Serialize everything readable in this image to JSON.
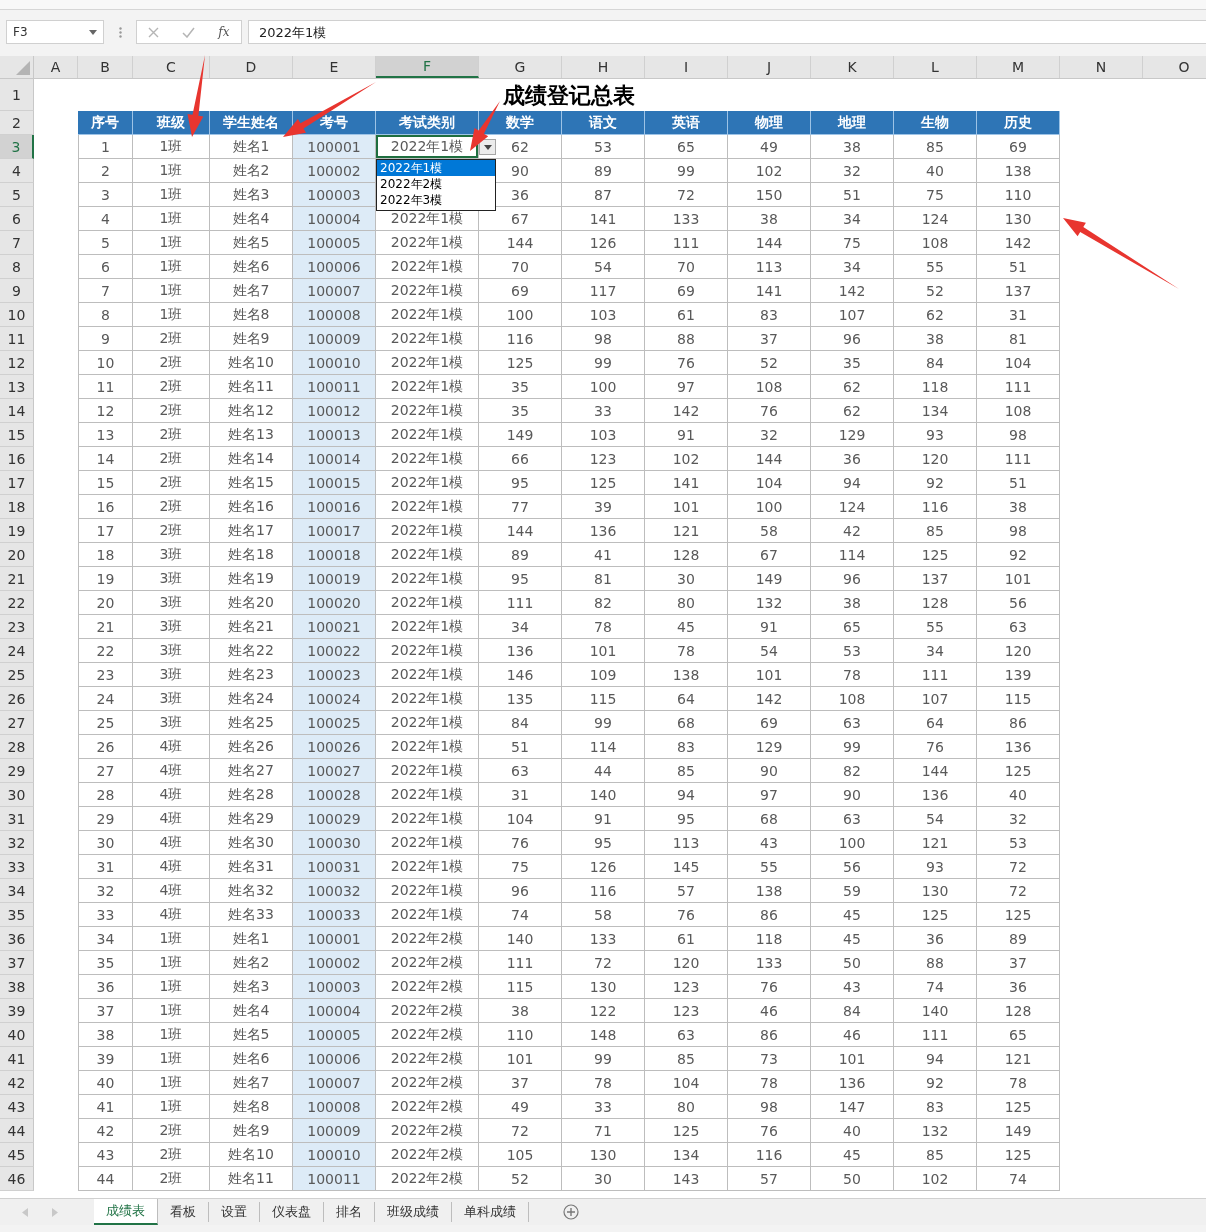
{
  "name_box": "F3",
  "formula_bar": {
    "function_label": "fx",
    "value": "2022年1模"
  },
  "column_headers": [
    {
      "label": "A",
      "selected": false
    },
    {
      "label": "B",
      "selected": false
    },
    {
      "label": "C",
      "selected": false
    },
    {
      "label": "D",
      "selected": false
    },
    {
      "label": "E",
      "selected": false
    },
    {
      "label": "F",
      "selected": true
    },
    {
      "label": "G",
      "selected": false
    },
    {
      "label": "H",
      "selected": false
    },
    {
      "label": "I",
      "selected": false
    },
    {
      "label": "J",
      "selected": false
    },
    {
      "label": "K",
      "selected": false
    },
    {
      "label": "L",
      "selected": false
    },
    {
      "label": "M",
      "selected": false
    },
    {
      "label": "N",
      "selected": false
    },
    {
      "label": "O",
      "selected": false
    }
  ],
  "row_headers": [
    {
      "label": "1"
    },
    {
      "label": "2"
    },
    {
      "label": "3"
    },
    {
      "label": "4"
    },
    {
      "label": "5"
    },
    {
      "label": "6"
    },
    {
      "label": "7"
    },
    {
      "label": "8"
    },
    {
      "label": "9"
    },
    {
      "label": "10"
    },
    {
      "label": "11"
    },
    {
      "label": "12"
    },
    {
      "label": "13"
    },
    {
      "label": "14"
    },
    {
      "label": "15"
    },
    {
      "label": "16"
    },
    {
      "label": "17"
    },
    {
      "label": "18"
    },
    {
      "label": "19"
    },
    {
      "label": "20"
    },
    {
      "label": "21"
    },
    {
      "label": "22"
    },
    {
      "label": "23"
    },
    {
      "label": "24"
    },
    {
      "label": "25"
    },
    {
      "label": "26"
    },
    {
      "label": "27"
    },
    {
      "label": "28"
    },
    {
      "label": "29"
    },
    {
      "label": "30"
    },
    {
      "label": "31"
    },
    {
      "label": "32"
    },
    {
      "label": "33"
    },
    {
      "label": "34"
    },
    {
      "label": "35"
    },
    {
      "label": "36"
    },
    {
      "label": "37"
    },
    {
      "label": "38"
    },
    {
      "label": "39"
    },
    {
      "label": "40"
    },
    {
      "label": "41"
    },
    {
      "label": "42"
    },
    {
      "label": "43"
    },
    {
      "label": "44"
    },
    {
      "label": "45"
    },
    {
      "label": "46"
    }
  ],
  "title": "成绩登记总表",
  "table": {
    "columns": [
      "序号",
      "班级",
      "学生姓名",
      "考号",
      "考试类别",
      "数学",
      "语文",
      "英语",
      "物理",
      "地理",
      "生物",
      "历史"
    ],
    "rows": [
      {
        "selected": true,
        "cells": [
          "1",
          "1班",
          "姓名1",
          "100001",
          "2022年1模",
          "62",
          "53",
          "65",
          "49",
          "38",
          "85",
          "69"
        ]
      },
      {
        "selected": false,
        "cells": [
          "2",
          "1班",
          "姓名2",
          "100002",
          null,
          "90",
          "89",
          "99",
          "102",
          "32",
          "40",
          "138"
        ]
      },
      {
        "selected": false,
        "cells": [
          "3",
          "1班",
          "姓名3",
          "100003",
          null,
          "36",
          "87",
          "72",
          "150",
          "51",
          "75",
          "110"
        ]
      },
      {
        "selected": false,
        "cells": [
          "4",
          "1班",
          "姓名4",
          "100004",
          "2022年1模",
          "67",
          "141",
          "133",
          "38",
          "34",
          "124",
          "130"
        ]
      },
      {
        "selected": false,
        "cells": [
          "5",
          "1班",
          "姓名5",
          "100005",
          "2022年1模",
          "144",
          "126",
          "111",
          "144",
          "75",
          "108",
          "142"
        ]
      },
      {
        "selected": false,
        "cells": [
          "6",
          "1班",
          "姓名6",
          "100006",
          "2022年1模",
          "70",
          "54",
          "70",
          "113",
          "34",
          "55",
          "51"
        ]
      },
      {
        "selected": false,
        "cells": [
          "7",
          "1班",
          "姓名7",
          "100007",
          "2022年1模",
          "69",
          "117",
          "69",
          "141",
          "142",
          "52",
          "137"
        ]
      },
      {
        "selected": false,
        "cells": [
          "8",
          "1班",
          "姓名8",
          "100008",
          "2022年1模",
          "100",
          "103",
          "61",
          "83",
          "107",
          "62",
          "31"
        ]
      },
      {
        "selected": false,
        "cells": [
          "9",
          "2班",
          "姓名9",
          "100009",
          "2022年1模",
          "116",
          "98",
          "88",
          "37",
          "96",
          "38",
          "81"
        ]
      },
      {
        "selected": false,
        "cells": [
          "10",
          "2班",
          "姓名10",
          "100010",
          "2022年1模",
          "125",
          "99",
          "76",
          "52",
          "35",
          "84",
          "104"
        ]
      },
      {
        "selected": false,
        "cells": [
          "11",
          "2班",
          "姓名11",
          "100011",
          "2022年1模",
          "35",
          "100",
          "97",
          "108",
          "62",
          "118",
          "111"
        ]
      },
      {
        "selected": false,
        "cells": [
          "12",
          "2班",
          "姓名12",
          "100012",
          "2022年1模",
          "35",
          "33",
          "142",
          "76",
          "62",
          "134",
          "108"
        ]
      },
      {
        "selected": false,
        "cells": [
          "13",
          "2班",
          "姓名13",
          "100013",
          "2022年1模",
          "149",
          "103",
          "91",
          "32",
          "129",
          "93",
          "98"
        ]
      },
      {
        "selected": false,
        "cells": [
          "14",
          "2班",
          "姓名14",
          "100014",
          "2022年1模",
          "66",
          "123",
          "102",
          "144",
          "36",
          "120",
          "111"
        ]
      },
      {
        "selected": false,
        "cells": [
          "15",
          "2班",
          "姓名15",
          "100015",
          "2022年1模",
          "95",
          "125",
          "141",
          "104",
          "94",
          "92",
          "51"
        ]
      },
      {
        "selected": false,
        "cells": [
          "16",
          "2班",
          "姓名16",
          "100016",
          "2022年1模",
          "77",
          "39",
          "101",
          "100",
          "124",
          "116",
          "38"
        ]
      },
      {
        "selected": false,
        "cells": [
          "17",
          "2班",
          "姓名17",
          "100017",
          "2022年1模",
          "144",
          "136",
          "121",
          "58",
          "42",
          "85",
          "98"
        ]
      },
      {
        "selected": false,
        "cells": [
          "18",
          "3班",
          "姓名18",
          "100018",
          "2022年1模",
          "89",
          "41",
          "128",
          "67",
          "114",
          "125",
          "92"
        ]
      },
      {
        "selected": false,
        "cells": [
          "19",
          "3班",
          "姓名19",
          "100019",
          "2022年1模",
          "95",
          "81",
          "30",
          "149",
          "96",
          "137",
          "101"
        ]
      },
      {
        "selected": false,
        "cells": [
          "20",
          "3班",
          "姓名20",
          "100020",
          "2022年1模",
          "111",
          "82",
          "80",
          "132",
          "38",
          "128",
          "56"
        ]
      },
      {
        "selected": false,
        "cells": [
          "21",
          "3班",
          "姓名21",
          "100021",
          "2022年1模",
          "34",
          "78",
          "45",
          "91",
          "65",
          "55",
          "63"
        ]
      },
      {
        "selected": false,
        "cells": [
          "22",
          "3班",
          "姓名22",
          "100022",
          "2022年1模",
          "136",
          "101",
          "78",
          "54",
          "53",
          "34",
          "120"
        ]
      },
      {
        "selected": false,
        "cells": [
          "23",
          "3班",
          "姓名23",
          "100023",
          "2022年1模",
          "146",
          "109",
          "138",
          "101",
          "78",
          "111",
          "139"
        ]
      },
      {
        "selected": false,
        "cells": [
          "24",
          "3班",
          "姓名24",
          "100024",
          "2022年1模",
          "135",
          "115",
          "64",
          "142",
          "108",
          "107",
          "115"
        ]
      },
      {
        "selected": false,
        "cells": [
          "25",
          "3班",
          "姓名25",
          "100025",
          "2022年1模",
          "84",
          "99",
          "68",
          "69",
          "63",
          "64",
          "86"
        ]
      },
      {
        "selected": false,
        "cells": [
          "26",
          "4班",
          "姓名26",
          "100026",
          "2022年1模",
          "51",
          "114",
          "83",
          "129",
          "99",
          "76",
          "136"
        ]
      },
      {
        "selected": false,
        "cells": [
          "27",
          "4班",
          "姓名27",
          "100027",
          "2022年1模",
          "63",
          "44",
          "85",
          "90",
          "82",
          "144",
          "125"
        ]
      },
      {
        "selected": false,
        "cells": [
          "28",
          "4班",
          "姓名28",
          "100028",
          "2022年1模",
          "31",
          "140",
          "94",
          "97",
          "90",
          "136",
          "40"
        ]
      },
      {
        "selected": false,
        "cells": [
          "29",
          "4班",
          "姓名29",
          "100029",
          "2022年1模",
          "104",
          "91",
          "95",
          "68",
          "63",
          "54",
          "32"
        ]
      },
      {
        "selected": false,
        "cells": [
          "30",
          "4班",
          "姓名30",
          "100030",
          "2022年1模",
          "76",
          "95",
          "113",
          "43",
          "100",
          "121",
          "53"
        ]
      },
      {
        "selected": false,
        "cells": [
          "31",
          "4班",
          "姓名31",
          "100031",
          "2022年1模",
          "75",
          "126",
          "145",
          "55",
          "56",
          "93",
          "72"
        ]
      },
      {
        "selected": false,
        "cells": [
          "32",
          "4班",
          "姓名32",
          "100032",
          "2022年1模",
          "96",
          "116",
          "57",
          "138",
          "59",
          "130",
          "72"
        ]
      },
      {
        "selected": false,
        "cells": [
          "33",
          "4班",
          "姓名33",
          "100033",
          "2022年1模",
          "74",
          "58",
          "76",
          "86",
          "45",
          "125",
          "125"
        ]
      },
      {
        "selected": false,
        "cells": [
          "34",
          "1班",
          "姓名1",
          "100001",
          "2022年2模",
          "140",
          "133",
          "61",
          "118",
          "45",
          "36",
          "89"
        ]
      },
      {
        "selected": false,
        "cells": [
          "35",
          "1班",
          "姓名2",
          "100002",
          "2022年2模",
          "111",
          "72",
          "120",
          "133",
          "50",
          "88",
          "37"
        ]
      },
      {
        "selected": false,
        "cells": [
          "36",
          "1班",
          "姓名3",
          "100003",
          "2022年2模",
          "115",
          "130",
          "123",
          "76",
          "43",
          "74",
          "36"
        ]
      },
      {
        "selected": false,
        "cells": [
          "37",
          "1班",
          "姓名4",
          "100004",
          "2022年2模",
          "38",
          "122",
          "123",
          "46",
          "84",
          "140",
          "128"
        ]
      },
      {
        "selected": false,
        "cells": [
          "38",
          "1班",
          "姓名5",
          "100005",
          "2022年2模",
          "110",
          "148",
          "63",
          "86",
          "46",
          "111",
          "65"
        ]
      },
      {
        "selected": false,
        "cells": [
          "39",
          "1班",
          "姓名6",
          "100006",
          "2022年2模",
          "101",
          "99",
          "85",
          "73",
          "101",
          "94",
          "121"
        ]
      },
      {
        "selected": false,
        "cells": [
          "40",
          "1班",
          "姓名7",
          "100007",
          "2022年2模",
          "37",
          "78",
          "104",
          "78",
          "136",
          "92",
          "78"
        ]
      },
      {
        "selected": false,
        "cells": [
          "41",
          "1班",
          "姓名8",
          "100008",
          "2022年2模",
          "49",
          "33",
          "80",
          "98",
          "147",
          "83",
          "125"
        ]
      },
      {
        "selected": false,
        "cells": [
          "42",
          "2班",
          "姓名9",
          "100009",
          "2022年2模",
          "72",
          "71",
          "125",
          "76",
          "40",
          "132",
          "149"
        ]
      },
      {
        "selected": false,
        "cells": [
          "43",
          "2班",
          "姓名10",
          "100010",
          "2022年2模",
          "105",
          "130",
          "134",
          "116",
          "45",
          "85",
          "125"
        ]
      },
      {
        "selected": false,
        "cells": [
          "44",
          "2班",
          "姓名11",
          "100011",
          "2022年2模",
          "52",
          "30",
          "143",
          "57",
          "50",
          "102",
          "74"
        ]
      }
    ]
  },
  "dropdown": {
    "expanded": true,
    "options": [
      {
        "label": "2022年1模",
        "selected": true
      },
      {
        "label": "2022年2模",
        "selected": false
      },
      {
        "label": "2022年3模",
        "selected": false
      }
    ]
  },
  "sheet_tabs": [
    {
      "label": "成绩表",
      "selected": true
    },
    {
      "label": "看板",
      "selected": false
    },
    {
      "label": "设置",
      "selected": false
    },
    {
      "label": "仪表盘",
      "selected": false
    },
    {
      "label": "排名",
      "selected": false
    },
    {
      "label": "班级成绩",
      "selected": false
    },
    {
      "label": "单科成绩",
      "selected": false
    }
  ]
}
